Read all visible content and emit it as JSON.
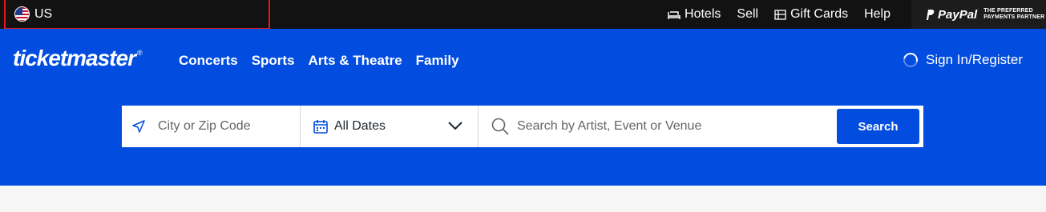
{
  "topbar": {
    "country": "US",
    "links": [
      {
        "label": "Hotels",
        "icon": "bed-icon"
      },
      {
        "label": "Sell",
        "icon": ""
      },
      {
        "label": "Gift Cards",
        "icon": "gift-card-icon"
      },
      {
        "label": "Help",
        "icon": ""
      }
    ],
    "paypal": {
      "logo": "PayPal",
      "tagline_1": "THE PREFERRED",
      "tagline_2": "PAYMENTS PARTNER"
    }
  },
  "header": {
    "logo": "ticketmaster",
    "logo_mark": "®",
    "nav": [
      "Concerts",
      "Sports",
      "Arts & Theatre",
      "Family"
    ],
    "signin": "Sign In/Register"
  },
  "search": {
    "location_placeholder": "City or Zip Code",
    "date_value": "All Dates",
    "query_placeholder": "Search by Artist, Event or Venue",
    "button": "Search"
  },
  "colors": {
    "brand_blue": "#024ddf",
    "topbar_bg": "#121212",
    "highlight_border": "#e01b1b"
  }
}
